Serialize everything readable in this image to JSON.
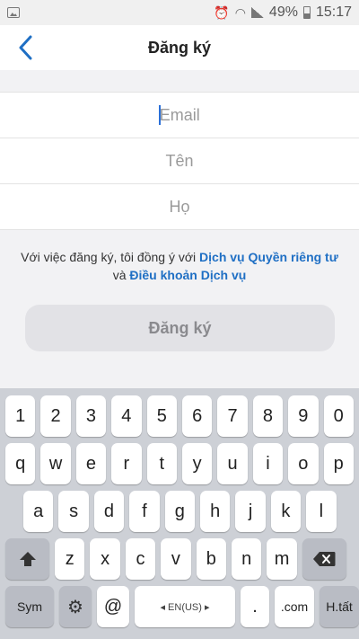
{
  "status": {
    "battery": "49%",
    "time": "15:17"
  },
  "nav": {
    "title": "Đăng ký"
  },
  "form": {
    "email_placeholder": "Email",
    "first_name_placeholder": "Tên",
    "last_name_placeholder": "Họ"
  },
  "terms": {
    "prefix": "Với việc đăng ký, tôi đồng ý với ",
    "privacy_link": "Dịch vụ Quyền riêng tư",
    "middle": " và ",
    "terms_link": "Điều khoản Dịch vụ"
  },
  "signup_button": "Đăng ký",
  "keyboard": {
    "numbers": [
      "1",
      "2",
      "3",
      "4",
      "5",
      "6",
      "7",
      "8",
      "9",
      "0"
    ],
    "row1": [
      "q",
      "w",
      "e",
      "r",
      "t",
      "y",
      "u",
      "i",
      "o",
      "p"
    ],
    "row2": [
      "a",
      "s",
      "d",
      "f",
      "g",
      "h",
      "j",
      "k",
      "l"
    ],
    "row3": [
      "z",
      "x",
      "c",
      "v",
      "b",
      "n",
      "m"
    ],
    "sym": "Sym",
    "at": "@",
    "space": "◂ EN(US) ▸",
    "dot": ".",
    "com": ".com",
    "done": "H.tất"
  }
}
